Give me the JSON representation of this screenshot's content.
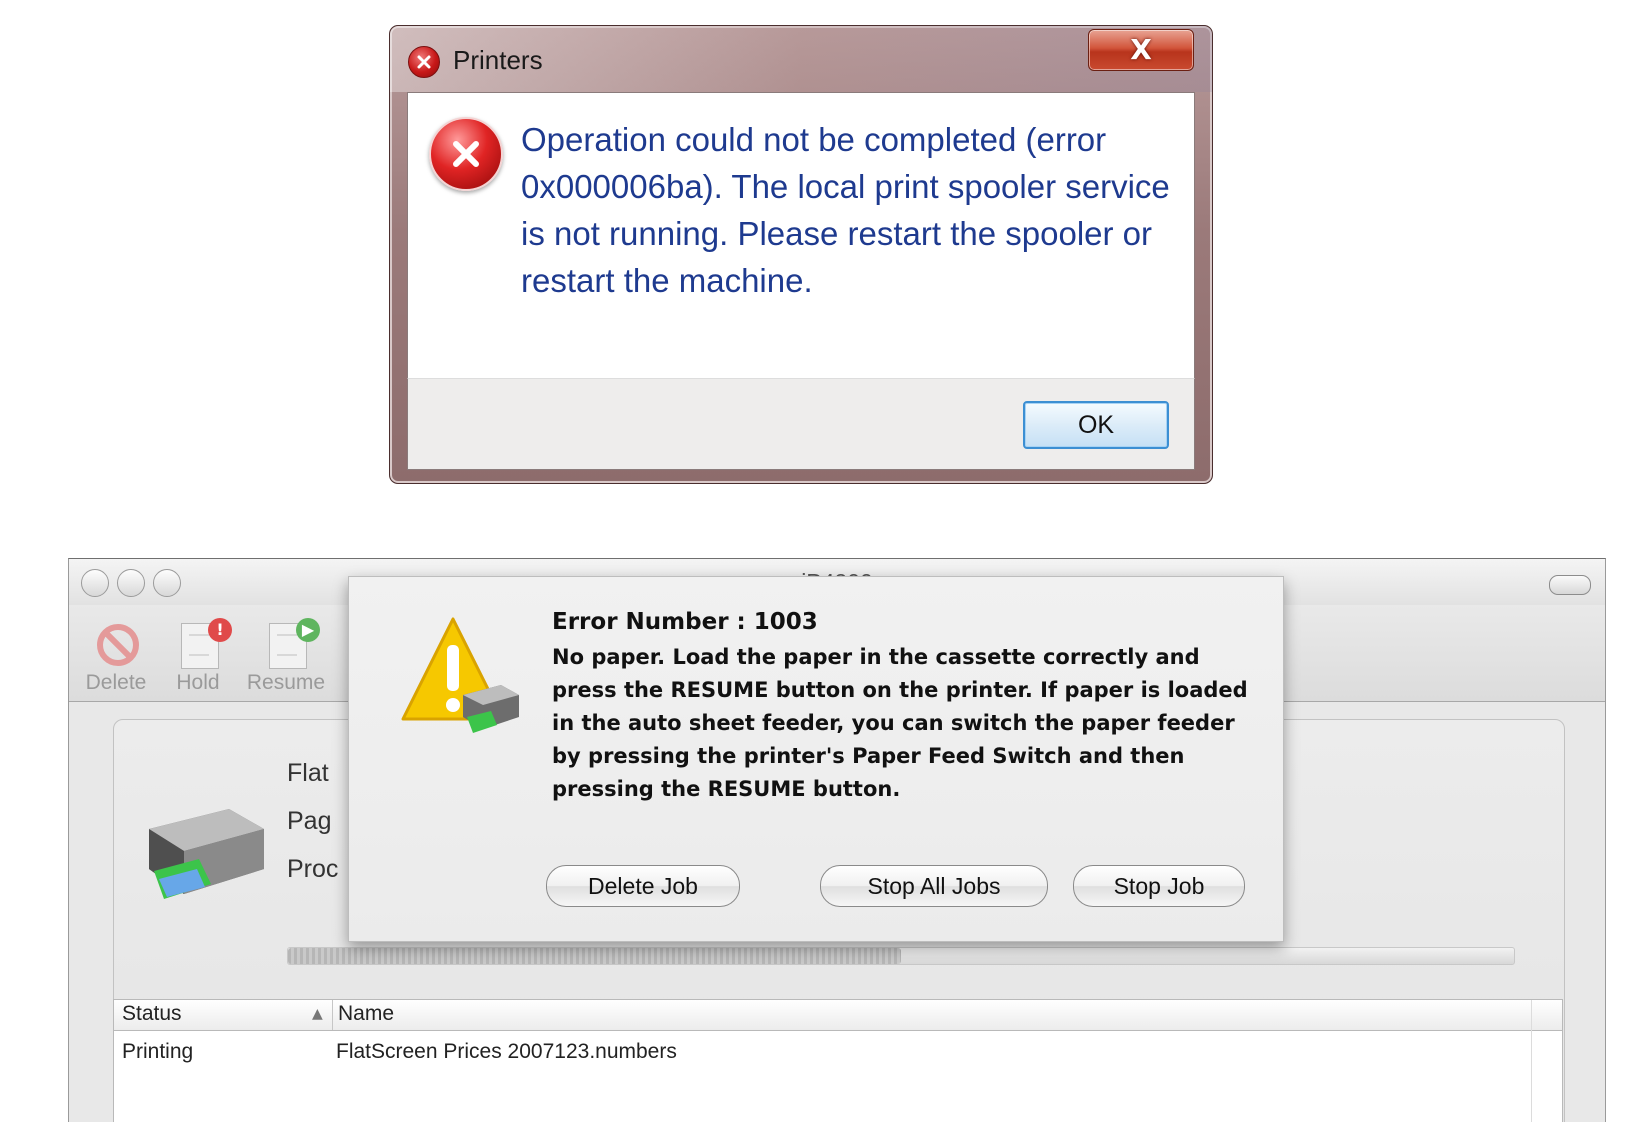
{
  "windows_dialog": {
    "title": "Printers",
    "message": "Operation could not be completed (error 0x000006ba). The local print spooler service is not running. Please restart the spooler or restart the machine.",
    "close_glyph": "X",
    "ok_label": "OK",
    "icons": {
      "title": "error-circle-icon",
      "main": "error-circle-icon",
      "close": "close-icon"
    }
  },
  "mac_window": {
    "title": "iP4200",
    "toolbar": [
      {
        "label": "Delete",
        "icon": "delete-icon"
      },
      {
        "label": "Hold",
        "icon": "hold-job-icon"
      },
      {
        "label": "Resume",
        "icon": "resume-job-icon"
      }
    ],
    "job_info": {
      "name_partial": "Flat",
      "pages_partial": "Pag",
      "status_partial": "Proc"
    },
    "table": {
      "columns": [
        "Status",
        "Name"
      ],
      "rows": [
        {
          "status": "Printing",
          "name": "FlatScreen Prices 2007123.numbers"
        }
      ]
    },
    "alert": {
      "title": "Error Number : 1003",
      "message": "No paper. Load the paper in the cassette correctly and press the RESUME button on the printer. If paper is loaded in the auto sheet feeder, you can switch the paper feeder by pressing the printer's Paper Feed Switch and then pressing the RESUME button.",
      "buttons": [
        "Delete Job",
        "Stop All Jobs",
        "Stop Job"
      ],
      "icon": "warning-printer-icon"
    }
  },
  "colors": {
    "win_message": "#1e3a8f",
    "win_close": "#c94a30",
    "error_red": "#d42020",
    "warning_yellow": "#f5c400"
  }
}
